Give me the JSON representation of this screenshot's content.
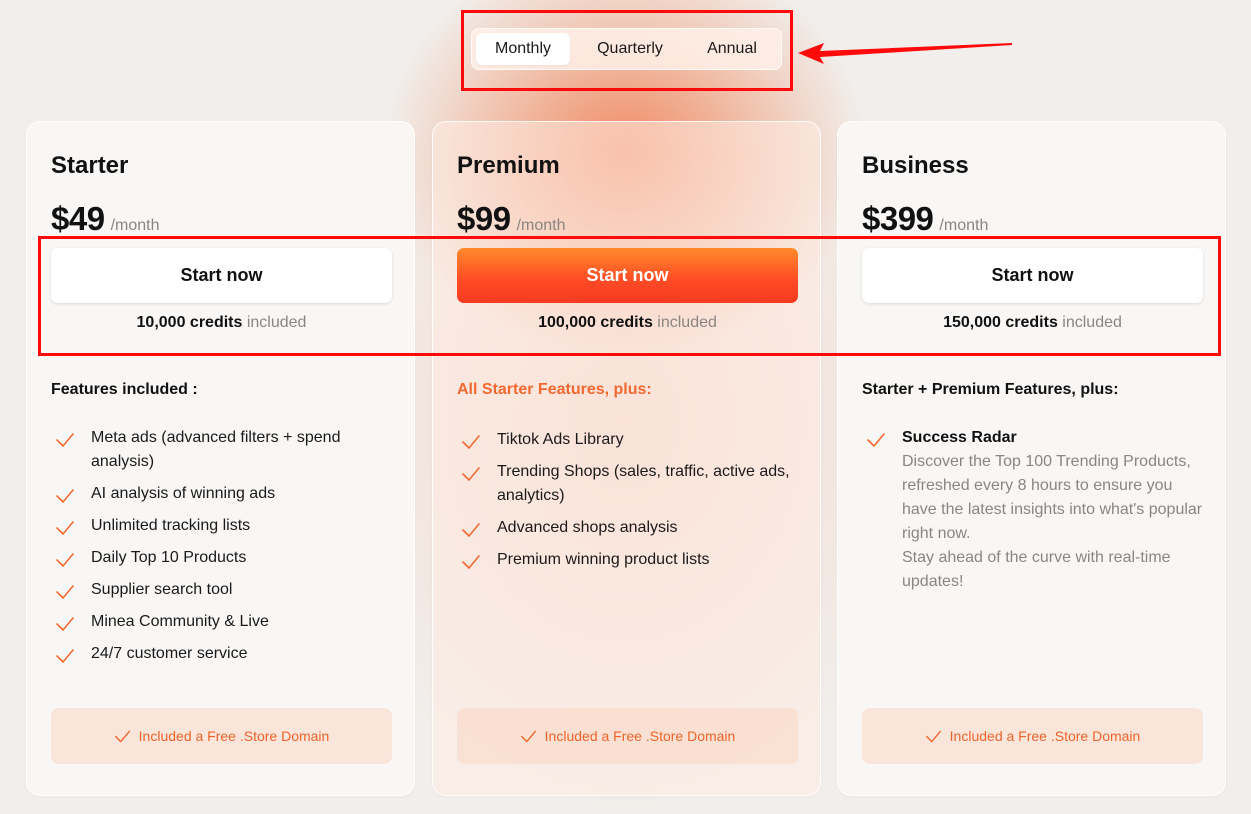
{
  "billing_toggle": {
    "options": [
      "Monthly",
      "Quarterly",
      "Annual"
    ],
    "selected": "Monthly"
  },
  "plans": [
    {
      "name": "Starter",
      "price": "$49",
      "period": "/month",
      "cta": "Start now",
      "credits": "10,000 credits",
      "credits_suffix": "included",
      "features_heading": "Features included :",
      "features": [
        "Meta ads (advanced filters + spend analysis)",
        "AI analysis of winning ads",
        "Unlimited tracking lists",
        "Daily Top 10 Products",
        "Supplier search tool",
        "Minea Community & Live",
        "24/7 customer service"
      ],
      "domain_note": "Included a Free .Store Domain"
    },
    {
      "name": "Premium",
      "price": "$99",
      "period": "/month",
      "cta": "Start now",
      "credits": "100,000 credits",
      "credits_suffix": "included",
      "features_heading": "All Starter Features, plus:",
      "features": [
        "Tiktok Ads Library",
        "Trending Shops (sales, traffic, active ads, analytics)",
        "Advanced shops analysis",
        "Premium winning product lists"
      ],
      "domain_note": "Included a Free .Store Domain"
    },
    {
      "name": "Business",
      "price": "$399",
      "period": "/month",
      "cta": "Start now",
      "credits": "150,000 credits",
      "credits_suffix": "included",
      "features_heading": "Starter + Premium Features, plus:",
      "features": [
        {
          "title": "Success Radar",
          "description": "Discover the Top 100 Trending Products, refreshed every 8 hours to ensure you have the latest insights into what's popular right now.",
          "description_2": "Stay ahead of the curve with real-time updates!"
        }
      ],
      "domain_note": "Included a Free .Store Domain"
    }
  ],
  "icons": {
    "feature_check": "check-icon",
    "annotation_arrow": "arrow-left-icon"
  },
  "colors": {
    "accent": "#f26a32",
    "primary_button_top": "#ff8a2a",
    "primary_button_bottom": "#f53a20",
    "annotation": "#ff0a0a"
  }
}
